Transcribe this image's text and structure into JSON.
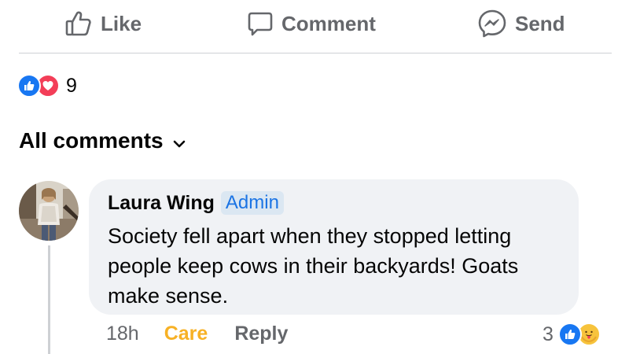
{
  "actions": {
    "like_label": "Like",
    "comment_label": "Comment",
    "send_label": "Send"
  },
  "post_reactions": {
    "types": [
      "like",
      "love"
    ],
    "count": "9"
  },
  "comments_filter": {
    "label": "All comments"
  },
  "comment": {
    "author": "Laura Wing",
    "badge": "Admin",
    "text": "Society fell apart when they stopped letting people keep cows in their backyards! Goats make sense.",
    "time": "18h",
    "care_label": "Care",
    "reply_label": "Reply",
    "reaction_count": "3",
    "reaction_types": [
      "like",
      "care"
    ]
  },
  "colors": {
    "like_blue": "#1877f2",
    "love_red": "#f33e58",
    "care_yellow": "#f7b125",
    "admin_blue": "#1b74e4",
    "bubble_bg": "#f0f2f5",
    "muted_text": "#65676b"
  }
}
